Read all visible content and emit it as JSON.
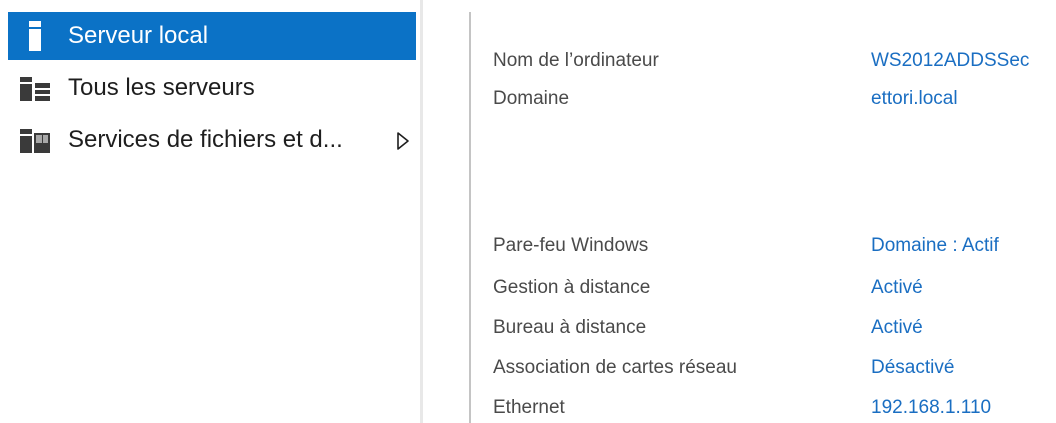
{
  "sidebar": {
    "items": [
      {
        "label": "Serveur local",
        "icon": "server-icon",
        "selected": true
      },
      {
        "label": "Tous les serveurs",
        "icon": "servers-icon",
        "selected": false
      },
      {
        "label": "Services de fichiers et d...",
        "icon": "file-services-icon",
        "selected": false,
        "has_submenu": true
      }
    ]
  },
  "properties": {
    "computer_name": {
      "label": "Nom de l’ordinateur",
      "value": "WS2012ADDSSec"
    },
    "domain": {
      "label": "Domaine",
      "value": "ettori.local"
    },
    "firewall": {
      "label": "Pare-feu Windows",
      "value": "Domaine : Actif"
    },
    "remote_management": {
      "label": "Gestion à distance",
      "value": "Activé"
    },
    "remote_desktop": {
      "label": "Bureau à distance",
      "value": "Activé"
    },
    "nic_teaming": {
      "label": "Association de cartes réseau",
      "value": "Désactivé"
    },
    "ethernet": {
      "label": "Ethernet",
      "value": "192.168.1.110"
    }
  },
  "colors": {
    "selection": "#0b72c6",
    "link": "#1a6ec2",
    "label": "#4a4a4a"
  }
}
